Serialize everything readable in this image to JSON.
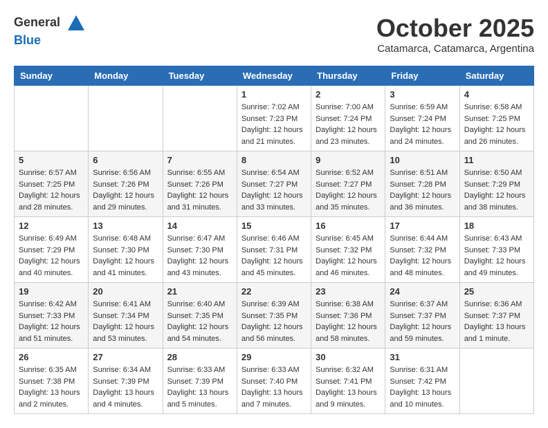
{
  "header": {
    "logo_general": "General",
    "logo_blue": "Blue",
    "month": "October 2025",
    "location": "Catamarca, Catamarca, Argentina"
  },
  "weekdays": [
    "Sunday",
    "Monday",
    "Tuesday",
    "Wednesday",
    "Thursday",
    "Friday",
    "Saturday"
  ],
  "weeks": [
    [
      {
        "day": "",
        "info": ""
      },
      {
        "day": "",
        "info": ""
      },
      {
        "day": "",
        "info": ""
      },
      {
        "day": "1",
        "info": "Sunrise: 7:02 AM\nSunset: 7:23 PM\nDaylight: 12 hours\nand 21 minutes."
      },
      {
        "day": "2",
        "info": "Sunrise: 7:00 AM\nSunset: 7:24 PM\nDaylight: 12 hours\nand 23 minutes."
      },
      {
        "day": "3",
        "info": "Sunrise: 6:59 AM\nSunset: 7:24 PM\nDaylight: 12 hours\nand 24 minutes."
      },
      {
        "day": "4",
        "info": "Sunrise: 6:58 AM\nSunset: 7:25 PM\nDaylight: 12 hours\nand 26 minutes."
      }
    ],
    [
      {
        "day": "5",
        "info": "Sunrise: 6:57 AM\nSunset: 7:25 PM\nDaylight: 12 hours\nand 28 minutes."
      },
      {
        "day": "6",
        "info": "Sunrise: 6:56 AM\nSunset: 7:26 PM\nDaylight: 12 hours\nand 29 minutes."
      },
      {
        "day": "7",
        "info": "Sunrise: 6:55 AM\nSunset: 7:26 PM\nDaylight: 12 hours\nand 31 minutes."
      },
      {
        "day": "8",
        "info": "Sunrise: 6:54 AM\nSunset: 7:27 PM\nDaylight: 12 hours\nand 33 minutes."
      },
      {
        "day": "9",
        "info": "Sunrise: 6:52 AM\nSunset: 7:27 PM\nDaylight: 12 hours\nand 35 minutes."
      },
      {
        "day": "10",
        "info": "Sunrise: 6:51 AM\nSunset: 7:28 PM\nDaylight: 12 hours\nand 36 minutes."
      },
      {
        "day": "11",
        "info": "Sunrise: 6:50 AM\nSunset: 7:29 PM\nDaylight: 12 hours\nand 38 minutes."
      }
    ],
    [
      {
        "day": "12",
        "info": "Sunrise: 6:49 AM\nSunset: 7:29 PM\nDaylight: 12 hours\nand 40 minutes."
      },
      {
        "day": "13",
        "info": "Sunrise: 6:48 AM\nSunset: 7:30 PM\nDaylight: 12 hours\nand 41 minutes."
      },
      {
        "day": "14",
        "info": "Sunrise: 6:47 AM\nSunset: 7:30 PM\nDaylight: 12 hours\nand 43 minutes."
      },
      {
        "day": "15",
        "info": "Sunrise: 6:46 AM\nSunset: 7:31 PM\nDaylight: 12 hours\nand 45 minutes."
      },
      {
        "day": "16",
        "info": "Sunrise: 6:45 AM\nSunset: 7:32 PM\nDaylight: 12 hours\nand 46 minutes."
      },
      {
        "day": "17",
        "info": "Sunrise: 6:44 AM\nSunset: 7:32 PM\nDaylight: 12 hours\nand 48 minutes."
      },
      {
        "day": "18",
        "info": "Sunrise: 6:43 AM\nSunset: 7:33 PM\nDaylight: 12 hours\nand 49 minutes."
      }
    ],
    [
      {
        "day": "19",
        "info": "Sunrise: 6:42 AM\nSunset: 7:33 PM\nDaylight: 12 hours\nand 51 minutes."
      },
      {
        "day": "20",
        "info": "Sunrise: 6:41 AM\nSunset: 7:34 PM\nDaylight: 12 hours\nand 53 minutes."
      },
      {
        "day": "21",
        "info": "Sunrise: 6:40 AM\nSunset: 7:35 PM\nDaylight: 12 hours\nand 54 minutes."
      },
      {
        "day": "22",
        "info": "Sunrise: 6:39 AM\nSunset: 7:35 PM\nDaylight: 12 hours\nand 56 minutes."
      },
      {
        "day": "23",
        "info": "Sunrise: 6:38 AM\nSunset: 7:36 PM\nDaylight: 12 hours\nand 58 minutes."
      },
      {
        "day": "24",
        "info": "Sunrise: 6:37 AM\nSunset: 7:37 PM\nDaylight: 12 hours\nand 59 minutes."
      },
      {
        "day": "25",
        "info": "Sunrise: 6:36 AM\nSunset: 7:37 PM\nDaylight: 13 hours\nand 1 minute."
      }
    ],
    [
      {
        "day": "26",
        "info": "Sunrise: 6:35 AM\nSunset: 7:38 PM\nDaylight: 13 hours\nand 2 minutes."
      },
      {
        "day": "27",
        "info": "Sunrise: 6:34 AM\nSunset: 7:39 PM\nDaylight: 13 hours\nand 4 minutes."
      },
      {
        "day": "28",
        "info": "Sunrise: 6:33 AM\nSunset: 7:39 PM\nDaylight: 13 hours\nand 5 minutes."
      },
      {
        "day": "29",
        "info": "Sunrise: 6:33 AM\nSunset: 7:40 PM\nDaylight: 13 hours\nand 7 minutes."
      },
      {
        "day": "30",
        "info": "Sunrise: 6:32 AM\nSunset: 7:41 PM\nDaylight: 13 hours\nand 9 minutes."
      },
      {
        "day": "31",
        "info": "Sunrise: 6:31 AM\nSunset: 7:42 PM\nDaylight: 13 hours\nand 10 minutes."
      },
      {
        "day": "",
        "info": ""
      }
    ]
  ]
}
